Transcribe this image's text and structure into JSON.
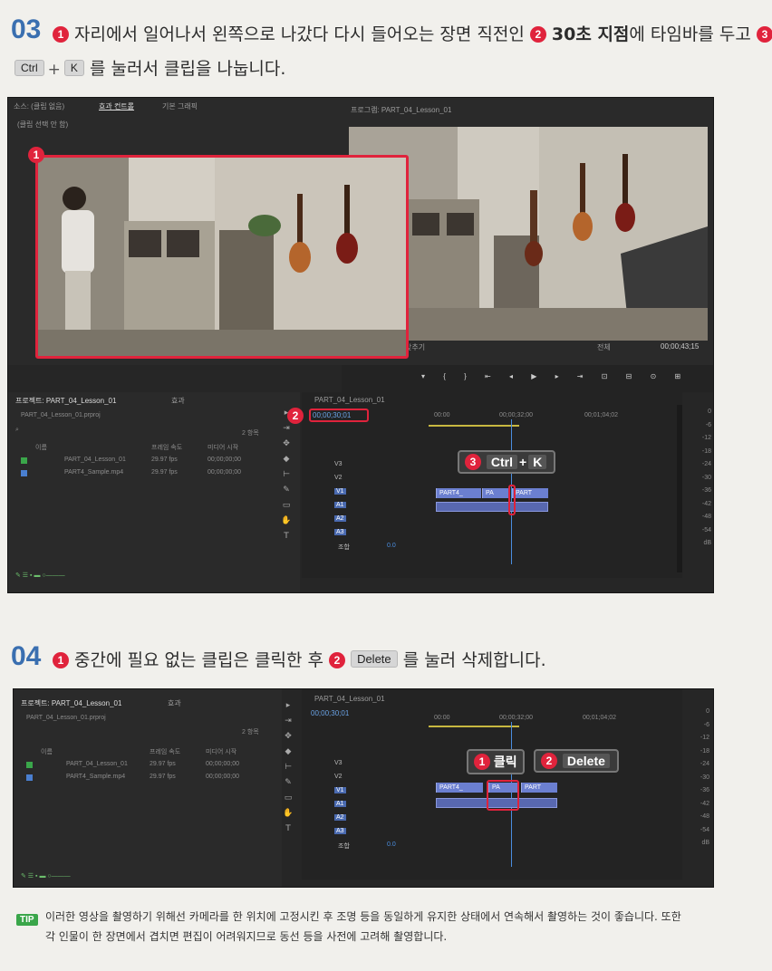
{
  "step03": {
    "number": "03",
    "n1": "1",
    "text1": "자리에서 일어나서 왼쪽으로 나갔다 다시 들어오는 장면 직전인",
    "n2": "2",
    "highlight": "30초 지점",
    "text2": "에 타임바를 두고",
    "n3": "3",
    "key1": "Ctrl",
    "plus": "+",
    "key2": "K",
    "text3": "를 눌러서 클립을 나눕니다."
  },
  "screen1": {
    "tabs": [
      "소스: (클립 없음)",
      "효과 컨트롤",
      "기본 그래픽"
    ],
    "no_clip": "(클립 선택 안 함)",
    "program_title": "프로그램: PART_04_Lesson_01",
    "fit_label": "맞추기",
    "full_label": "전체",
    "total_time": "00;00;43;15",
    "badge1": "1",
    "badge2": "2",
    "badge3": "3",
    "timecode_current": "00;00;30;01",
    "callout_key1": "Ctrl",
    "callout_plus": "+",
    "callout_key2": "K"
  },
  "project": {
    "title": "프로젝트: PART_04_Lesson_01",
    "effects_tab": "효과",
    "file": "PART_04_Lesson_01.prproj",
    "count": "2 항목",
    "col_name": "이름",
    "col_fps": "프레임 속도",
    "col_start": "미디어 시작",
    "rows": [
      {
        "name": "PART_04_Lesson_01",
        "fps": "29.97 fps",
        "start": "00;00;00;00"
      },
      {
        "name": "PART4_Sample.mp4",
        "fps": "29.97 fps",
        "start": "00;00;00;00"
      }
    ]
  },
  "timeline": {
    "seq_name": "PART_04_Lesson_01",
    "ruler": [
      "00:00",
      "00;00;32;00",
      "00;01;04;02"
    ],
    "tracks_v": [
      "V3",
      "V2",
      "V1"
    ],
    "tracks_a": [
      "A1",
      "A2",
      "A3"
    ],
    "mix_label": "조합",
    "mix_value": "0.0",
    "clips1": [
      "PART4_",
      "PA",
      "PART"
    ],
    "clips2": [
      "PART4_",
      "PA",
      "PART"
    ],
    "meter": [
      "0",
      "-6",
      "-12",
      "-18",
      "-24",
      "-30",
      "-36",
      "-42",
      "-48",
      "-54",
      "dB"
    ]
  },
  "step04": {
    "number": "04",
    "n1": "1",
    "text1": "중간에 필요 없는 클립은 클릭한 후",
    "n2": "2",
    "key": "Delete",
    "text2": "를 눌러 삭제합니다."
  },
  "screen2": {
    "timecode": "00;00;30;01",
    "callout1_num": "1",
    "callout1": "클릭",
    "callout2_num": "2",
    "callout2": "Delete"
  },
  "tip": {
    "label": "TIP",
    "line1": "이러한 영상을 촬영하기 위해선 카메라를 한 위치에 고정시킨 후 조명 등을 동일하게 유지한 상태에서 연속해서 촬영하는 것이 좋습니다. 또한",
    "line2": "각 인물이 한 장면에서 겹치면 편집이 어려워지므로 동선 등을 사전에 고려해 촬영합니다."
  }
}
